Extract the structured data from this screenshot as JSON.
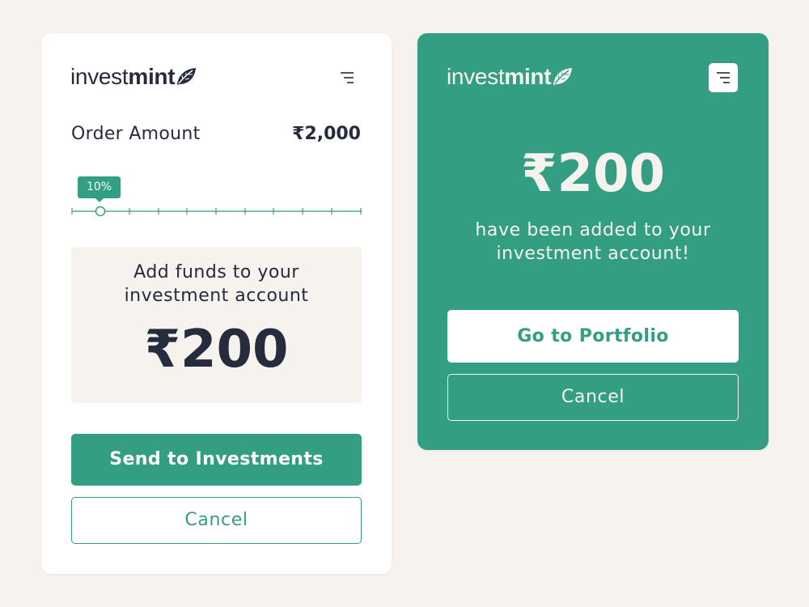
{
  "colors": {
    "brand": "#349e82",
    "text_dark": "#262b3d",
    "background": "#f6f3ee",
    "card": "#ffffff"
  },
  "left_card": {
    "logo": {
      "part1": "invest",
      "part2": "mint",
      "icon": "leaf-icon"
    },
    "menu_icon": "menu-icon",
    "order_label": "Order Amount",
    "order_value": "₹2,000",
    "slider": {
      "label": "10%",
      "value_fraction": 0.1
    },
    "fund_text_line1": "Add funds to your",
    "fund_text_line2": "investment account",
    "fund_amount": "₹200",
    "primary_button": "Send to Investments",
    "cancel_button": "Cancel"
  },
  "right_card": {
    "logo": {
      "part1": "invest",
      "part2": "mint",
      "icon": "leaf-icon"
    },
    "menu_icon": "menu-icon",
    "amount": "₹200",
    "message_line1": "have been added to your",
    "message_line2": "investment account!",
    "primary_button": "Go to Portfolio",
    "cancel_button": "Cancel"
  }
}
